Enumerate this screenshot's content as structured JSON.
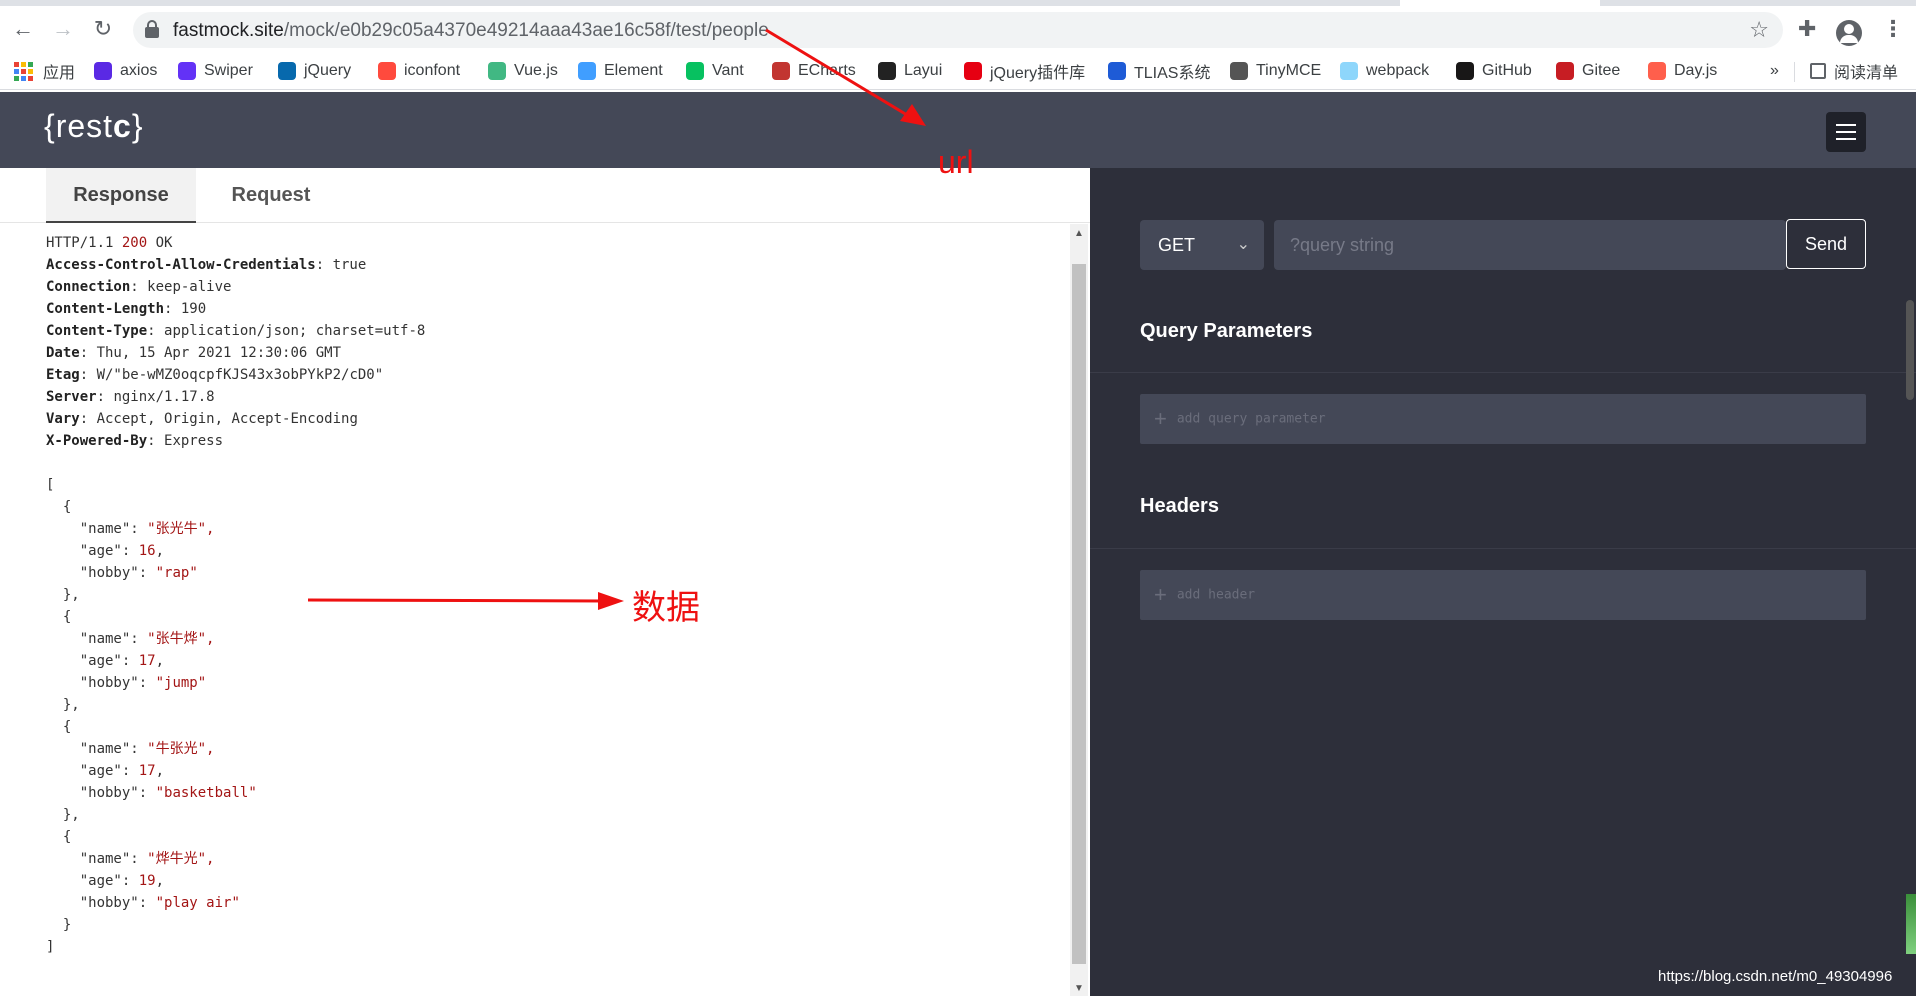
{
  "browser": {
    "url_host": "fastmock.site",
    "url_path": "/mock/e0b29c05a4370e49214aaa43ae16c58f/test/people"
  },
  "bookmarks": [
    {
      "label": "应用",
      "icon": "apps-grid-icon",
      "color": "#ea4335"
    },
    {
      "label": "axios",
      "icon": "axios-icon",
      "color": "#5a29e4"
    },
    {
      "label": "Swiper",
      "icon": "swiper-icon",
      "color": "#6332f6"
    },
    {
      "label": "jQuery",
      "icon": "jquery-icon",
      "color": "#0769ad"
    },
    {
      "label": "iconfont",
      "icon": "iconfont-icon",
      "color": "#ff4a3d"
    },
    {
      "label": "Vue.js",
      "icon": "vue-icon",
      "color": "#41b883"
    },
    {
      "label": "Element",
      "icon": "element-icon",
      "color": "#409eff"
    },
    {
      "label": "Vant",
      "icon": "vant-icon",
      "color": "#07c160"
    },
    {
      "label": "ECharts",
      "icon": "echarts-icon",
      "color": "#c23531"
    },
    {
      "label": "Layui",
      "icon": "layui-icon",
      "color": "#222222"
    },
    {
      "label": "jQuery插件库",
      "icon": "jquery-plugin-icon",
      "color": "#e60012"
    },
    {
      "label": "TLIAS系统",
      "icon": "tlias-icon",
      "color": "#1e5bd6"
    },
    {
      "label": "TinyMCE",
      "icon": "tinymce-icon",
      "color": "#555555"
    },
    {
      "label": "webpack",
      "icon": "webpack-icon",
      "color": "#8ed6fb"
    },
    {
      "label": "GitHub",
      "icon": "github-icon",
      "color": "#181717"
    },
    {
      "label": "Gitee",
      "icon": "gitee-icon",
      "color": "#c71d23"
    },
    {
      "label": "Day.js",
      "icon": "dayjs-icon",
      "color": "#ff5f4c"
    }
  ],
  "bookmarks_more": "»",
  "reading_list": "阅读清单",
  "app": {
    "logo_open": "{",
    "logo_text": "rest",
    "logo_c": "c",
    "logo_close": "}"
  },
  "tabs": {
    "response": "Response",
    "request": "Request"
  },
  "response": {
    "status_proto": "HTTP/1.1 ",
    "status_code": "200",
    "status_text": " OK",
    "headers": [
      {
        "name": "Access-Control-Allow-Credentials",
        "value": "true"
      },
      {
        "name": "Connection",
        "value": "keep-alive"
      },
      {
        "name": "Content-Length",
        "value": "190"
      },
      {
        "name": "Content-Type",
        "value": "application/json; charset=utf-8"
      },
      {
        "name": "Date",
        "value": "Thu, 15 Apr 2021 12:30:06 GMT"
      },
      {
        "name": "Etag",
        "value": "W/\"be-wMZ0oqcpfKJS43x3obPYkP2/cD0\""
      },
      {
        "name": "Server",
        "value": "nginx/1.17.8"
      },
      {
        "name": "Vary",
        "value": "Accept, Origin, Accept-Encoding"
      },
      {
        "name": "X-Powered-By",
        "value": "Express"
      }
    ],
    "body": [
      {
        "name": "张光牛",
        "age": "16",
        "hobby": "rap"
      },
      {
        "name": "张牛烨",
        "age": "17",
        "hobby": "jump"
      },
      {
        "name": "牛张光",
        "age": "17",
        "hobby": "basketball"
      },
      {
        "name": "烨牛光",
        "age": "19",
        "hobby": "play air"
      }
    ]
  },
  "request_panel": {
    "method": "GET",
    "query_placeholder": "?query string",
    "send": "Send",
    "query_params_title": "Query Parameters",
    "add_query_param": "add query parameter",
    "headers_title": "Headers",
    "add_header": "add header"
  },
  "annotations": {
    "url_label": "url",
    "data_label": "数据",
    "color": "#ee1111"
  },
  "watermark": "https://blog.csdn.net/m0_49304996"
}
